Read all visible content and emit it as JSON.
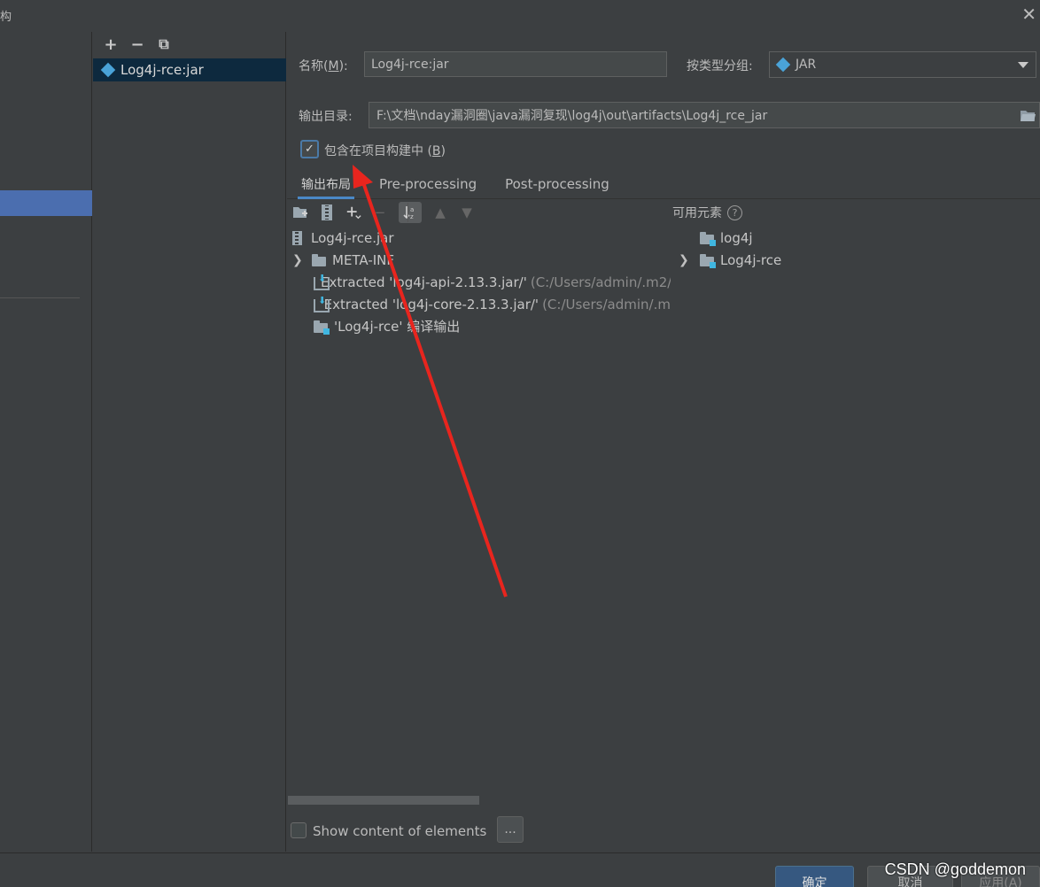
{
  "window": {
    "title_fragment": "构",
    "close_glyph": "✕"
  },
  "artifact_list": {
    "toolbar": {
      "add": "+",
      "remove": "−",
      "copy": "⧉"
    },
    "items": [
      {
        "label": "Log4j-rce:jar",
        "icon": "jar-icon",
        "selected": true
      }
    ]
  },
  "form": {
    "name_label": "名称(",
    "name_mnemonic": "M",
    "name_label_end": "):",
    "name_value": "Log4j-rce:jar",
    "type_label": "按类型分组:",
    "type_value": "JAR",
    "output_dir_label": "输出目录:",
    "output_dir_value": "F:\\文档\\nday漏洞圈\\java漏洞复现\\log4j\\out\\artifacts\\Log4j_rce_jar",
    "include_label": "包含在项目构建中 (",
    "include_mnemonic": "B",
    "include_label_end": ")",
    "include_checked": true
  },
  "tabs": [
    {
      "label": "输出布局",
      "active": true
    },
    {
      "label": "Pre-processing",
      "active": false
    },
    {
      "label": "Post-processing",
      "active": false
    }
  ],
  "layout_tree": {
    "root": "Log4j-rce.jar",
    "items": [
      {
        "label": "META-INF",
        "icon": "folder-icon",
        "expandable": true
      },
      {
        "label": "Extracted 'log4j-api-2.13.3.jar/'",
        "path": "(C:/Users/admin/.m2/",
        "icon": "extract-icon"
      },
      {
        "label": "Extracted 'log4j-core-2.13.3.jar/'",
        "path": "(C:/Users/admin/.m",
        "icon": "extract-icon"
      },
      {
        "label": "'Log4j-rce' 编译输出",
        "icon": "module-folder-icon"
      }
    ]
  },
  "available": {
    "header": "可用元素",
    "help": "?",
    "items": [
      {
        "label": "log4j",
        "expandable": false
      },
      {
        "label": "Log4j-rce",
        "expandable": true
      }
    ]
  },
  "show_content": {
    "label": "Show content of elements",
    "checked": false,
    "more_button": "..."
  },
  "buttons": {
    "ok": "确定",
    "cancel": "取消",
    "apply": "应用(A)"
  },
  "watermark": "CSDN @goddemon",
  "colors": {
    "background": "#3c3f41",
    "selection": "#0d293e",
    "accent": "#4b6eaf",
    "primary_button": "#365880",
    "annotation_arrow": "#e8251e"
  }
}
